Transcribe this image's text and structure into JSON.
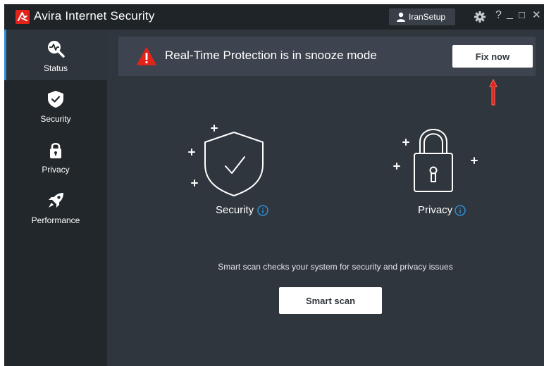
{
  "titlebar": {
    "app_title": "Avira Internet Security",
    "user_label": "IranSetup",
    "help_glyph": "?",
    "minimize_glyph": "_",
    "maximize_glyph": "□",
    "close_glyph": "✕"
  },
  "sidebar": {
    "items": [
      {
        "label": "Status",
        "icon": "status-magnifier-icon",
        "active": true
      },
      {
        "label": "Security",
        "icon": "shield-check-icon",
        "active": false
      },
      {
        "label": "Privacy",
        "icon": "padlock-icon",
        "active": false
      },
      {
        "label": "Performance",
        "icon": "rocket-icon",
        "active": false
      }
    ]
  },
  "alert": {
    "message": "Real-Time Protection is in snooze mode",
    "button_label": "Fix now",
    "icon": "warning-triangle-icon"
  },
  "features": {
    "security_label": "Security",
    "privacy_label": "Privacy",
    "info_glyph": "i"
  },
  "scan": {
    "description": "Smart scan checks your system for security and privacy issues",
    "button_label": "Smart scan"
  },
  "colors": {
    "brand_red": "#e2231a",
    "titlebar_bg": "#1f2428",
    "sidebar_bg": "#22272c",
    "main_bg": "#30363d",
    "alert_bg": "#3d4450",
    "warning_red": "#e2231a",
    "info_blue": "#2d8fd5",
    "active_indicator": "#2d8fd5"
  }
}
